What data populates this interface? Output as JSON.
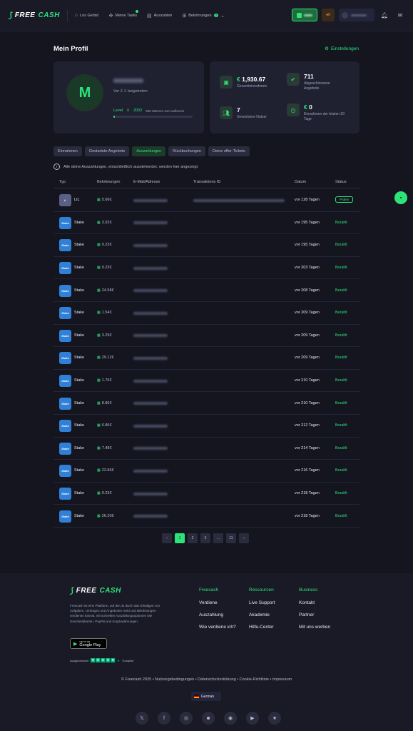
{
  "brand": {
    "part1": "FREE",
    "part2": "CASH"
  },
  "nav": {
    "items": [
      {
        "label": "Los Gehts!",
        "icon": "gamepad-icon"
      },
      {
        "label": "Meine Tasks",
        "icon": "tasks-icon"
      },
      {
        "label": "Auszahlen",
        "icon": "wallet-icon"
      },
      {
        "label": "Belohnungen",
        "icon": "gift-icon",
        "badge": "2"
      }
    ]
  },
  "topbar": {
    "coin_count": "0"
  },
  "page": {
    "title": "Mein Profil",
    "settings_label": "Einstellungen"
  },
  "profile": {
    "avatar_letter": "M",
    "joined": "Vor 2 J. beigetreten",
    "level_label": "Level",
    "level_value": "2002",
    "level_needed": "590 Münzen zum aufleveln",
    "level_progress": 0.02
  },
  "stats": {
    "earnings_value": "1,930.67",
    "earnings_currency": "€",
    "earnings_label": "Gesamteinnahmen",
    "offers_value": "711",
    "offers_label": "Abgeschlossene Angebote",
    "referrals_value": "7",
    "referrals_label": "Geworbene Nutzer",
    "recent_value": "0",
    "recent_currency": "€",
    "recent_label": "Einnahmen der letzten 30 Tage"
  },
  "tabs": [
    "Einnahmen",
    "Gestartete Angebote",
    "Auszahlungen",
    "Rückbuchungen",
    "Deine offer-Tickets"
  ],
  "active_tab": 2,
  "note": "Alle deine Auszahlungen, einschließlich ausstehender, werden hier angezeigt",
  "table": {
    "headers": [
      "Typ",
      "Belohnungen",
      "E-Mail/Adresse",
      "Transaktions ID",
      "Datum",
      "Status"
    ],
    "rows": [
      {
        "icon": "litecoin-icon",
        "icon_text": "Ł",
        "name": "Ltc",
        "reward": "5.66€",
        "date": "vor 128 Tagen",
        "status": "Prüfen",
        "pending": true
      },
      {
        "icon": "stake-icon",
        "icon_text": "Stake",
        "name": "Stake",
        "reward": "3.02€",
        "date": "vor 195 Tagen",
        "status": "Bezahlt",
        "pending": false
      },
      {
        "icon": "stake-icon",
        "icon_text": "Stake",
        "name": "Stake",
        "reward": "0.23€",
        "date": "vor 195 Tagen",
        "status": "Bezahlt",
        "pending": false
      },
      {
        "icon": "stake-icon",
        "icon_text": "Stake",
        "name": "Stake",
        "reward": "0.23€",
        "date": "vor 203 Tagen",
        "status": "Bezahlt",
        "pending": false
      },
      {
        "icon": "stake-icon",
        "icon_text": "Stake",
        "name": "Stake",
        "reward": "24.58€",
        "date": "vor 208 Tagen",
        "status": "Bezahlt",
        "pending": false
      },
      {
        "icon": "stake-icon",
        "icon_text": "Stake",
        "name": "Stake",
        "reward": "1.54€",
        "date": "vor 209 Tagen",
        "status": "Bezahlt",
        "pending": false
      },
      {
        "icon": "stake-icon",
        "icon_text": "Stake",
        "name": "Stake",
        "reward": "3.29€",
        "date": "vor 209 Tagen",
        "status": "Bezahlt",
        "pending": false
      },
      {
        "icon": "stake-icon",
        "icon_text": "Stake",
        "name": "Stake",
        "reward": "29.12€",
        "date": "vor 209 Tagen",
        "status": "Bezahlt",
        "pending": false
      },
      {
        "icon": "stake-icon",
        "icon_text": "Stake",
        "name": "Stake",
        "reward": "1.76€",
        "date": "vor 210 Tagen",
        "status": "Bezahlt",
        "pending": false
      },
      {
        "icon": "stake-icon",
        "icon_text": "Stake",
        "name": "Stake",
        "reward": "8.86€",
        "date": "vor 210 Tagen",
        "status": "Bezahlt",
        "pending": false
      },
      {
        "icon": "stake-icon",
        "icon_text": "Stake",
        "name": "Stake",
        "reward": "6.86€",
        "date": "vor 212 Tagen",
        "status": "Bezahlt",
        "pending": false
      },
      {
        "icon": "stake-icon",
        "icon_text": "Stake",
        "name": "Stake",
        "reward": "7.48€",
        "date": "vor 214 Tagen",
        "status": "Bezahlt",
        "pending": false
      },
      {
        "icon": "stake-icon",
        "icon_text": "Stake",
        "name": "Stake",
        "reward": "23.86€",
        "date": "vor 216 Tagen",
        "status": "Bezahlt",
        "pending": false
      },
      {
        "icon": "stake-icon",
        "icon_text": "Stake",
        "name": "Stake",
        "reward": "0.23€",
        "date": "vor 218 Tagen",
        "status": "Bezahlt",
        "pending": false
      },
      {
        "icon": "stake-icon",
        "icon_text": "Stake",
        "name": "Stake",
        "reward": "26.20€",
        "date": "vor 218 Tagen",
        "status": "Bezahlt",
        "pending": false
      }
    ]
  },
  "pagination": {
    "prev": "‹",
    "pages": [
      "1",
      "2",
      "3",
      "...",
      "11"
    ],
    "next": "›",
    "active": "1"
  },
  "footer": {
    "description": "Freecash ist eine Plattform, auf der du durch das Erledigen von Aufgaben, Umfragen und Angeboten Geld und Belohnungen verdienen kannst, mit schnellen Auszahlungsoptionen wie Geschenkkarten, PayPal und Kryptowährungen.",
    "gplay_small": "GET IT ON",
    "gplay_big": "Google Play",
    "trust_label": "Ausgezeichnet",
    "trust_brand": "Trustpilot",
    "columns": [
      {
        "heading": "Freecash",
        "links": [
          "Verdiene",
          "Auszahlung",
          "Wie verdiene ich?"
        ]
      },
      {
        "heading": "Ressourcen",
        "links": [
          "Live Support",
          "Akademie",
          "Hilfe-Center"
        ]
      },
      {
        "heading": "Business",
        "links": [
          "Kontakt",
          "Partner",
          "Mit uns werben"
        ]
      }
    ],
    "legal": "© Freecash 2025  •  Nutzungsbedingungen  •  Datenschutzerklärung  •  Cookie-Richtlinie  •  Impressum",
    "language": "German",
    "socials": [
      "x-icon",
      "facebook-icon",
      "instagram-icon",
      "reddit-icon",
      "discord-icon",
      "youtube-icon",
      "trustpilot-icon"
    ]
  },
  "colors": {
    "accent": "#2ee27a",
    "bg": "#14151f",
    "card": "#1f2131",
    "stake": "#2f80d6",
    "ltc": "#5a5f85"
  }
}
